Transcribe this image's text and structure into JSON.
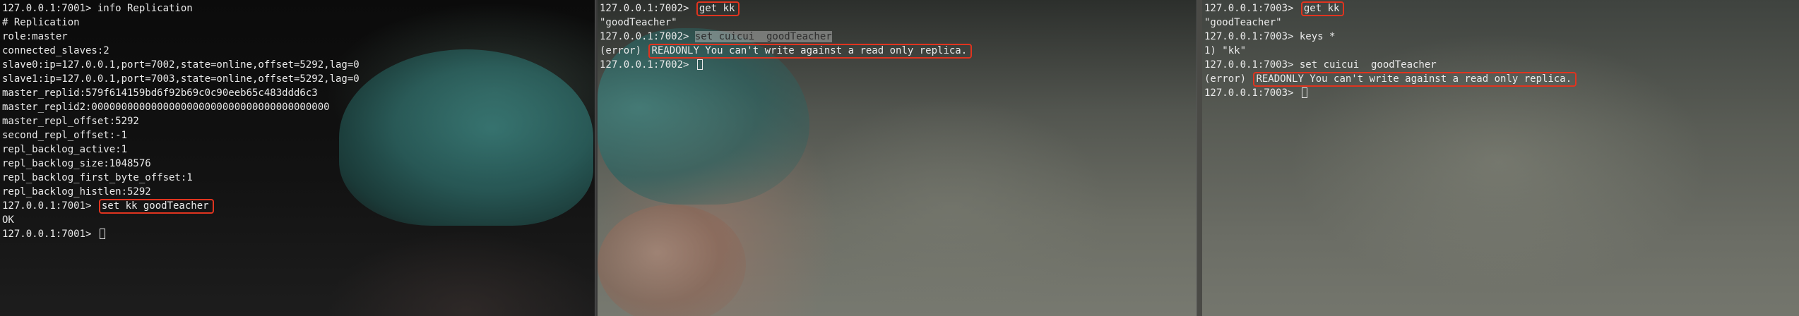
{
  "panes": {
    "left": {
      "lines": [
        "127.0.0.1:7001> info Replication",
        "# Replication",
        "role:master",
        "connected_slaves:2",
        "slave0:ip=127.0.0.1,port=7002,state=online,offset=5292,lag=0",
        "slave1:ip=127.0.0.1,port=7003,state=online,offset=5292,lag=0",
        "master_replid:579f614159bd6f92b69c0c90eeb65c483ddd6c3",
        "master_replid2:0000000000000000000000000000000000000000",
        "master_repl_offset:5292",
        "second_repl_offset:-1",
        "repl_backlog_active:1",
        "repl_backlog_size:1048576",
        "repl_backlog_first_byte_offset:1",
        "repl_backlog_histlen:5292"
      ],
      "cmd_prompt": "127.0.0.1:7001> ",
      "cmd": "set kk goodTeacher",
      "result": "OK",
      "final_prompt": "127.0.0.1:7001> "
    },
    "middle": {
      "prompt1": "127.0.0.1:7002> ",
      "cmd1": "get kk",
      "result1": "\"goodTeacher\"",
      "prompt2": "127.0.0.1:7002> ",
      "cmd2": "set cuicui  goodTeacher",
      "error_prefix": "(error) ",
      "error_msg": "READONLY You can't write against a read only replica.",
      "final_prompt": "127.0.0.1:7002> "
    },
    "right": {
      "prompt1": "127.0.0.1:7003> ",
      "cmd1": "get kk",
      "result1": "\"goodTeacher\"",
      "prompt2": "127.0.0.1:7003> ",
      "cmd2": "keys *",
      "result2": "1) \"kk\"",
      "prompt3": "127.0.0.1:7003> ",
      "cmd3": "set cuicui  goodTeacher",
      "error_prefix": "(error) ",
      "error_msg": "READONLY You can't write against a read only replica.",
      "final_prompt": "127.0.0.1:7003> "
    }
  },
  "colors": {
    "highlight": "#e0341f",
    "text": "#e9e9e9"
  }
}
